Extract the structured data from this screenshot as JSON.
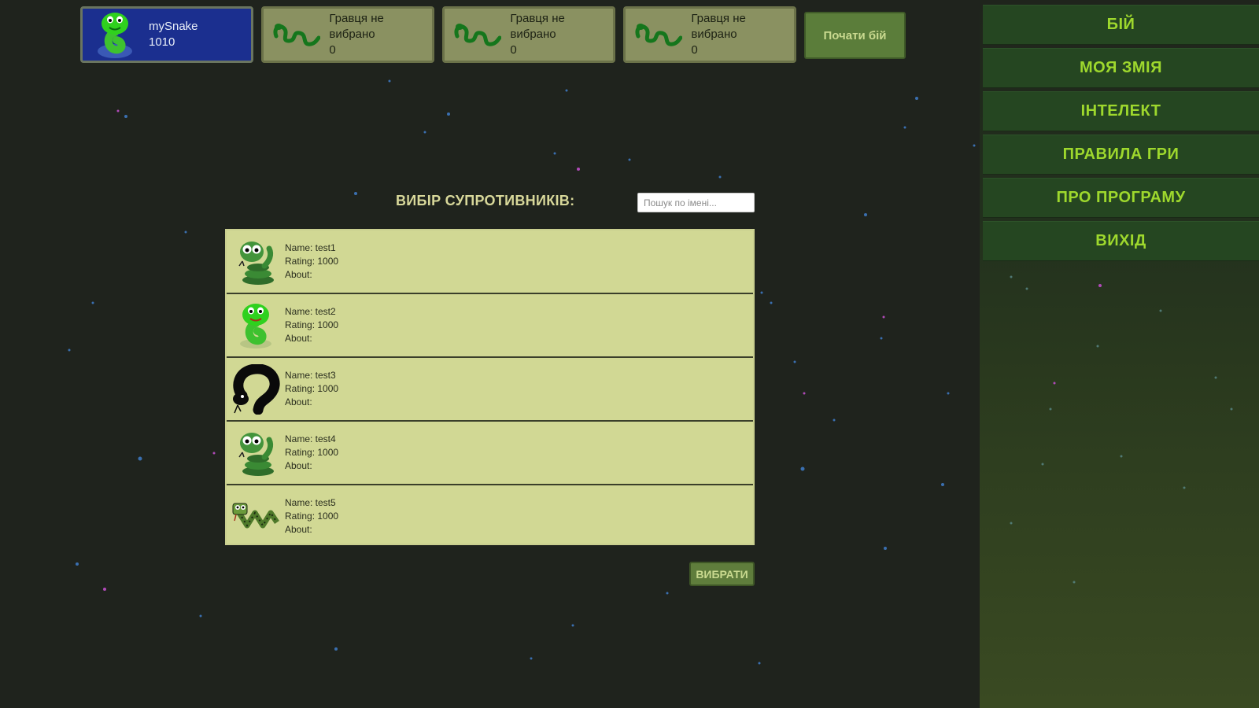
{
  "players": [
    {
      "name": "mySnake",
      "rating": "1010",
      "avatar_icon": "green-snake-icon",
      "active": true
    },
    {
      "name": "Гравця не вибрано",
      "rating": "0",
      "avatar_icon": "squiggle-snake-icon",
      "active": false
    },
    {
      "name": "Гравця не вибрано",
      "rating": "0",
      "avatar_icon": "squiggle-snake-icon",
      "active": false
    },
    {
      "name": "Гравця не вибрано",
      "rating": "0",
      "avatar_icon": "squiggle-snake-icon",
      "active": false
    }
  ],
  "start_battle_label": "Почати бій",
  "section_title": "ВИБІР СУПРОТИВНИКІВ:",
  "search": {
    "placeholder": "Пошук по імені...",
    "value": ""
  },
  "opponents": [
    {
      "name": "Name: test1",
      "rating": "Rating: 1000",
      "about": "About:",
      "avatar_icon": "coiled-snake-icon"
    },
    {
      "name": "Name: test2",
      "rating": "Rating: 1000",
      "about": "About:",
      "avatar_icon": "green-snake-icon"
    },
    {
      "name": "Name: test3",
      "rating": "Rating: 1000",
      "about": "About:",
      "avatar_icon": "black-snake-icon"
    },
    {
      "name": "Name: test4",
      "rating": "Rating: 1000",
      "about": "About:",
      "avatar_icon": "coiled-snake-icon"
    },
    {
      "name": "Name: test5",
      "rating": "Rating: 1000",
      "about": "About:",
      "avatar_icon": "zigzag-snake-icon"
    }
  ],
  "select_label": "ВИБРАТИ",
  "menu": [
    {
      "label": "БІЙ"
    },
    {
      "label": "МОЯ ЗМІЯ"
    },
    {
      "label": "ІНТЕЛЕКТ"
    },
    {
      "label": "ПРАВИЛА ГРИ"
    },
    {
      "label": "ПРО ПРОГРАМУ"
    },
    {
      "label": "ВИХІД"
    }
  ],
  "colors": {
    "background": "#1f231d",
    "active_slot": "#1b2f8f",
    "empty_slot": "#8a9161",
    "list_bg": "#d1d894",
    "menu_bg": "#254621",
    "menu_text": "#9ed82d"
  }
}
